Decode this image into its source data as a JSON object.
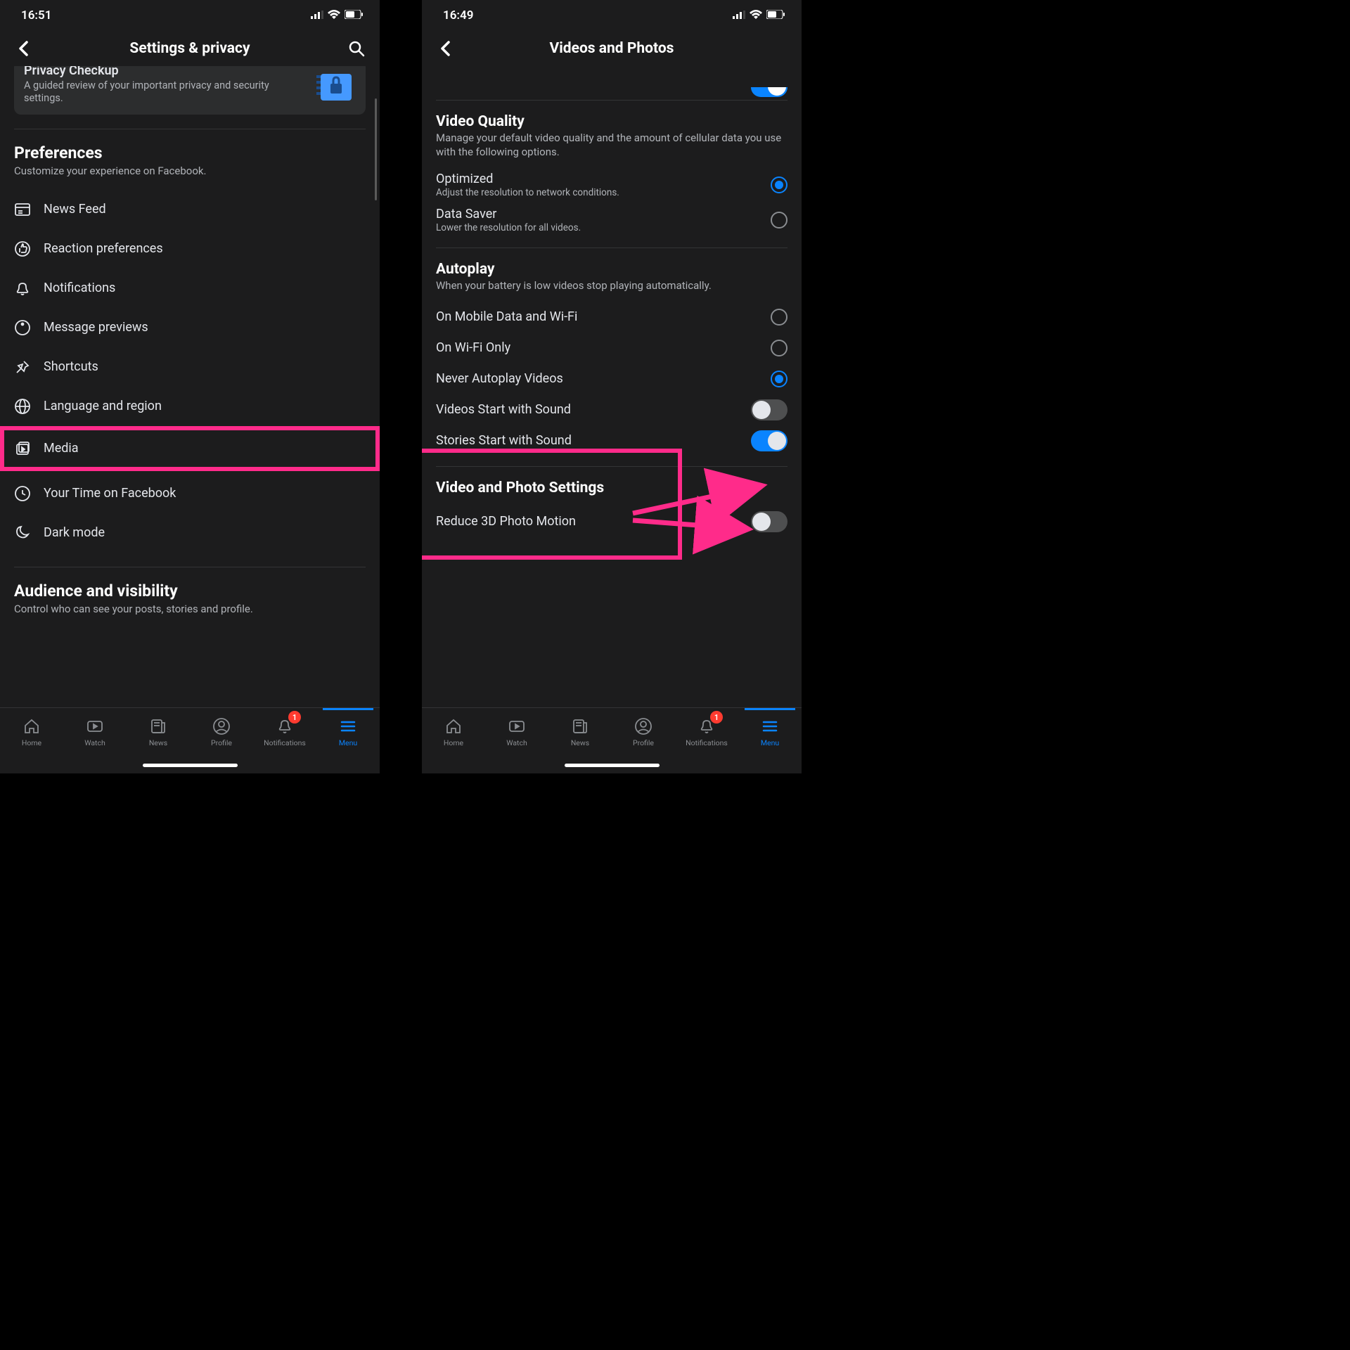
{
  "left": {
    "statusTime": "16:51",
    "navTitle": "Settings & privacy",
    "card": {
      "title": "Privacy Checkup",
      "sub": "A guided review of your important privacy and security settings."
    },
    "prefs": {
      "title": "Preferences",
      "sub": "Customize your experience on Facebook.",
      "items": [
        "News Feed",
        "Reaction preferences",
        "Notifications",
        "Message previews",
        "Shortcuts",
        "Language and region",
        "Media",
        "Your Time on Facebook",
        "Dark mode"
      ]
    },
    "audience": {
      "title": "Audience and visibility",
      "sub": "Control who can see your posts, stories and profile."
    }
  },
  "right": {
    "statusTime": "16:49",
    "navTitle": "Videos and Photos",
    "videoQuality": {
      "title": "Video Quality",
      "sub": "Manage your default video quality and the amount of cellular data you use with the following options.",
      "options": [
        {
          "label": "Optimized",
          "sub": "Adjust the resolution to network conditions.",
          "selected": true
        },
        {
          "label": "Data Saver",
          "sub": "Lower the resolution for all videos.",
          "selected": false
        }
      ]
    },
    "autoplay": {
      "title": "Autoplay",
      "sub": "When your battery is low videos stop playing automatically.",
      "radios": [
        {
          "label": "On Mobile Data and Wi-Fi",
          "selected": false
        },
        {
          "label": "On Wi-Fi Only",
          "selected": false
        },
        {
          "label": "Never Autoplay Videos",
          "selected": true
        }
      ],
      "toggles": [
        {
          "label": "Videos Start with Sound",
          "on": false
        },
        {
          "label": "Stories Start with Sound",
          "on": true
        }
      ]
    },
    "videoPhoto": {
      "title": "Video and Photo Settings",
      "toggles": [
        {
          "label": "Reduce 3D Photo Motion",
          "on": false
        }
      ]
    }
  },
  "tabs": {
    "items": [
      "Home",
      "Watch",
      "News",
      "Profile",
      "Notifications",
      "Menu"
    ],
    "badge": "1"
  }
}
